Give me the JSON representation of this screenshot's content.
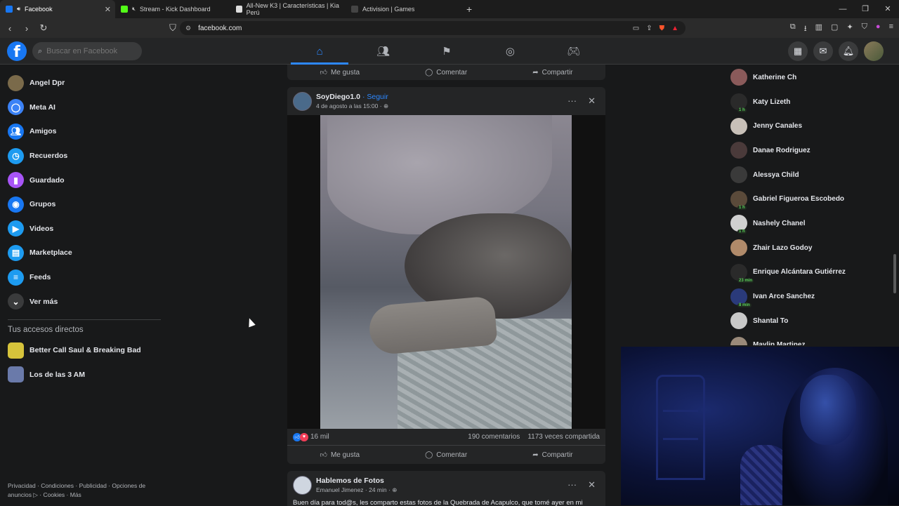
{
  "browser": {
    "tabs": [
      {
        "title": "Facebook",
        "color": "#1877f2",
        "active": true
      },
      {
        "title": "Stream - Kick Dashboard",
        "color": "#53fc18",
        "active": false
      },
      {
        "title": "All-New K3 | Características | Kia Perú",
        "color": "#dddddd",
        "active": false
      },
      {
        "title": "Activision | Games",
        "color": "#444444",
        "active": false
      }
    ],
    "url": "facebook.com"
  },
  "fb": {
    "search_placeholder": "Buscar en Facebook",
    "nav": [
      "home-icon",
      "friends-icon",
      "pages-icon",
      "groups-icon",
      "gaming-icon"
    ]
  },
  "sidebar": {
    "items": [
      {
        "label": "Angel Dpr",
        "icon": "profile-avatar",
        "color": "#7a6a4a"
      },
      {
        "label": "Meta AI",
        "icon": "meta-ai-icon",
        "color": "#3b82f6"
      },
      {
        "label": "Amigos",
        "icon": "friends-icon",
        "color": "#1877f2"
      },
      {
        "label": "Recuerdos",
        "icon": "memories-icon",
        "color": "#1d9bf0"
      },
      {
        "label": "Guardado",
        "icon": "saved-icon",
        "color": "#a855f7"
      },
      {
        "label": "Grupos",
        "icon": "groups-icon",
        "color": "#1877f2"
      },
      {
        "label": "Videos",
        "icon": "video-icon",
        "color": "#1d9bf0"
      },
      {
        "label": "Marketplace",
        "icon": "marketplace-icon",
        "color": "#1d9bf0"
      },
      {
        "label": "Feeds",
        "icon": "feeds-icon",
        "color": "#1d9bf0"
      },
      {
        "label": "Ver más",
        "icon": "chevron-down-icon",
        "color": "#3a3b3c"
      }
    ],
    "shortcuts_title": "Tus accesos directos",
    "shortcuts": [
      {
        "label": "Better Call Saul & Breaking Bad",
        "color": "#d6c33b"
      },
      {
        "label": "Los de las 3 AM",
        "color": "#6a7aaa"
      }
    ],
    "footer_line1": "Privacidad · Condiciones · Publicidad · Opciones de",
    "footer_line2": "anuncios ▷ · Cookies · Más"
  },
  "feed": {
    "prev_actions": {
      "like": "Me gusta",
      "comment": "Comentar",
      "share": "Compartir"
    },
    "post": {
      "author": "SoyDiego1.0",
      "follow": " · Seguir",
      "date": "4 de agosto a las 15:00 · ",
      "reactions": "16 mil",
      "comments": "190 comentarios",
      "shares": "1173 veces compartida",
      "like": "Me gusta",
      "comment": "Comentar",
      "share": "Compartir"
    },
    "post2": {
      "author": "Hablemos de Fotos",
      "meta": "Emanuel Jimenez · 24 min · ",
      "text": "Buen día para tod@s, les comparto estas fotos de la Quebrada de Acapulco, que tomé ayer en mi"
    }
  },
  "contacts": [
    {
      "name": "Katherine Ch",
      "badge": "",
      "color": "#8a5a5a"
    },
    {
      "name": "Katy Lizeth",
      "badge": "1 h",
      "color": "#2a2a2a"
    },
    {
      "name": "Jenny Canales",
      "badge": "",
      "color": "#c8c0b8"
    },
    {
      "name": "Danae Rodriguez",
      "badge": "",
      "color": "#4a3a3a"
    },
    {
      "name": "Alessya Child",
      "badge": "",
      "color": "#3a3a3a"
    },
    {
      "name": "Gabriel Figueroa Escobedo",
      "badge": "1 h",
      "color": "#5a4a3a"
    },
    {
      "name": "Nashely Chanel",
      "badge": "1 h",
      "color": "#d0d0d0"
    },
    {
      "name": "Zhair Lazo Godoy",
      "badge": "",
      "color": "#b08a6a"
    },
    {
      "name": "Enrique Alcántara Gutiérrez",
      "badge": "23 min",
      "color": "#2a2a2a"
    },
    {
      "name": "Ivan Arce Sanchez",
      "badge": "8 min",
      "color": "#2a3a7a"
    },
    {
      "name": "Shantal To",
      "badge": "",
      "color": "#c8c8c8"
    },
    {
      "name": "Maylin Martinez",
      "badge": "",
      "color": "#9a8a7a"
    }
  ]
}
